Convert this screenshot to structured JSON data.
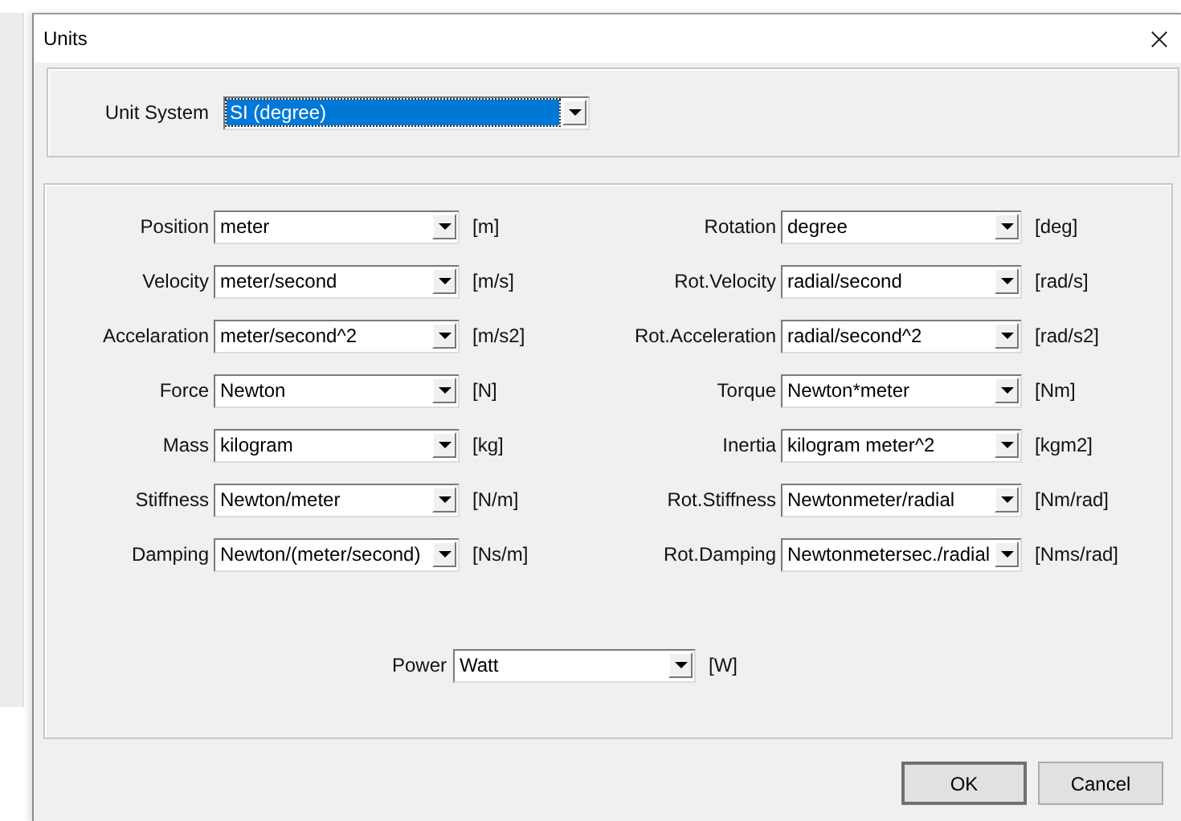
{
  "window": {
    "title": "Units"
  },
  "unit_system": {
    "label": "Unit System",
    "value": "SI (degree)",
    "focused": true
  },
  "left_fields": [
    {
      "label": "Position",
      "value": "meter",
      "unit": "[m]"
    },
    {
      "label": "Velocity",
      "value": "meter/second",
      "unit": "[m/s]"
    },
    {
      "label": "Accelaration",
      "value": "meter/second^2",
      "unit": "[m/s2]"
    },
    {
      "label": "Force",
      "value": "Newton",
      "unit": "[N]"
    },
    {
      "label": "Mass",
      "value": "kilogram",
      "unit": "[kg]"
    },
    {
      "label": "Stiffness",
      "value": "Newton/meter",
      "unit": "[N/m]"
    },
    {
      "label": "Damping",
      "value": "Newton/(meter/second)",
      "unit": "[Ns/m]"
    }
  ],
  "right_fields": [
    {
      "label": "Rotation",
      "value": "degree",
      "unit": "[deg]"
    },
    {
      "label": "Rot.Velocity",
      "value": "radial/second",
      "unit": "[rad/s]"
    },
    {
      "label": "Rot.Acceleration",
      "value": "radial/second^2",
      "unit": "[rad/s2]"
    },
    {
      "label": "Torque",
      "value": "Newton*meter",
      "unit": "[Nm]"
    },
    {
      "label": "Inertia",
      "value": "kilogram meter^2",
      "unit": "[kgm2]"
    },
    {
      "label": "Rot.Stiffness",
      "value": "Newtonmeter/radial",
      "unit": "[Nm/rad]"
    },
    {
      "label": "Rot.Damping",
      "value": "Newtonmetersec./radial",
      "unit": "[Nms/rad]"
    }
  ],
  "power": {
    "label": "Power",
    "value": "Watt",
    "unit": "[W]"
  },
  "buttons": [
    {
      "label": "OK",
      "default": true
    },
    {
      "label": "Cancel",
      "default": false
    }
  ]
}
